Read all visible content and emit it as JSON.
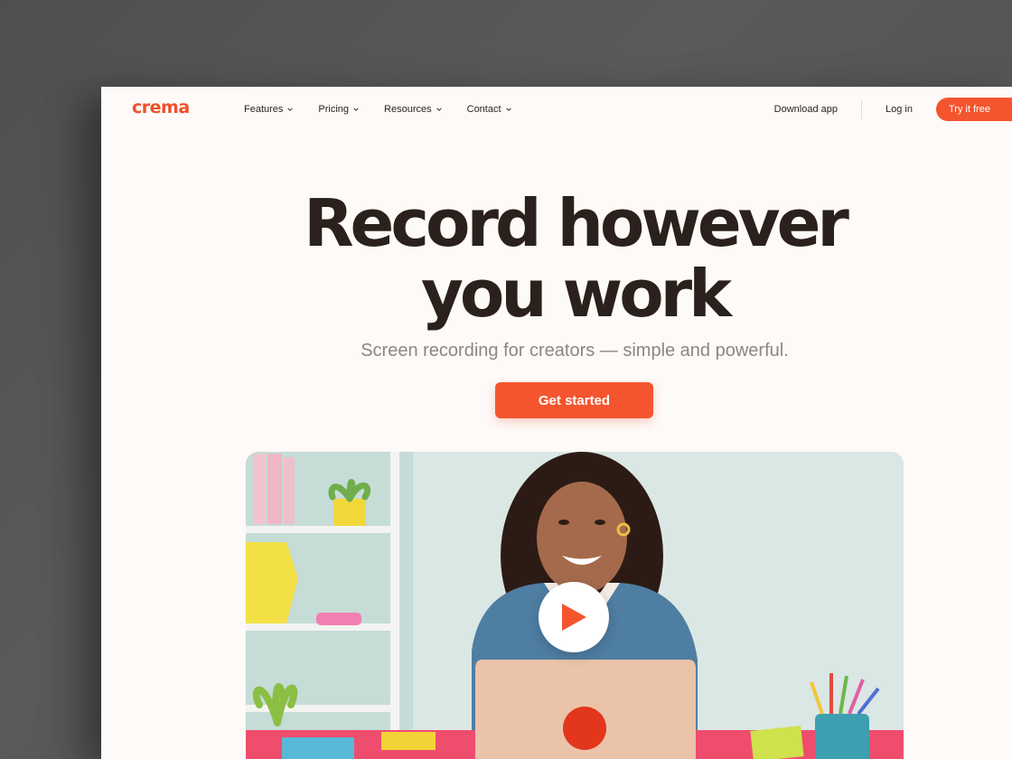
{
  "brand": {
    "logo_text": "crema",
    "accent_color": "#f4552e",
    "text_color": "#2b211c"
  },
  "nav": {
    "items": [
      {
        "label": "Features"
      },
      {
        "label": "Pricing"
      },
      {
        "label": "Resources"
      },
      {
        "label": "Contact"
      }
    ],
    "download_label": "Download app",
    "login_label": "Log in",
    "try_label": "Try it free"
  },
  "hero": {
    "title_line1": "Record however",
    "title_line2": "you work",
    "subtitle": "Screen recording for creators — simple and powerful.",
    "cta_label": "Get started"
  },
  "media": {
    "description_icon": "play-icon"
  }
}
